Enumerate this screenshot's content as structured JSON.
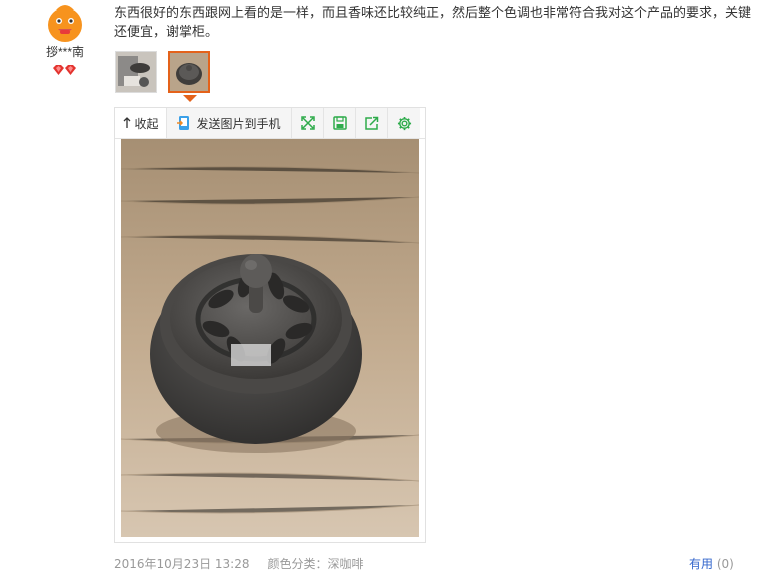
{
  "user": {
    "name": "拶***南",
    "avatar_icon": "orange-mascot-icon",
    "vip_icon": "double-diamond-icon"
  },
  "review": {
    "text": "东西很好的东西跟网上看的是一样，而且香味还比较纯正，然后整个色调也非常符合我对这个产品的要求，关键还便宜，谢掌柜。"
  },
  "thumbnails": [
    "photo-thumbnail-1",
    "photo-thumbnail-2"
  ],
  "viewer": {
    "collapse_label": "收起",
    "send_label": "发送图片到手机",
    "toolbar_icons": [
      "fullscreen-icon",
      "save-icon",
      "share-icon",
      "settings-icon"
    ],
    "accent_color": "#2eab4b"
  },
  "meta": {
    "date": "2016年10月23日 13:28",
    "color_category": "颜色分类：深咖啡",
    "useful_label": "有用",
    "useful_count": "(0)"
  },
  "colors": {
    "selected_thumb_border": "#e4621a",
    "link_blue": "#3366cc",
    "meta_gray": "#999999"
  }
}
